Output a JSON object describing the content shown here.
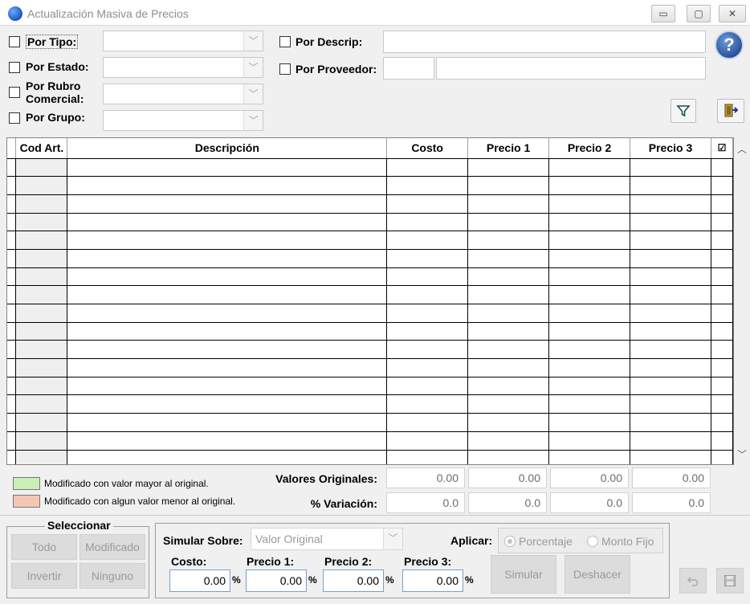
{
  "window": {
    "title": "Actualización Masiva de Precios",
    "controls": {
      "minimize": "▭",
      "maximize": "▢",
      "close": "✕"
    }
  },
  "filters": {
    "por_tipo": "Por Tipo:",
    "por_estado": "Por Estado:",
    "por_rubro_1": "Por Rubro",
    "por_rubro_2": "Comercial:",
    "por_grupo": "Por Grupo:",
    "por_descrip": "Por Descrip:",
    "por_proveedor": "Por Proveedor:",
    "combo_arrow": "﹀"
  },
  "help_label": "?",
  "icons": {
    "filter": "filter-icon",
    "exit": "exit-door-icon",
    "undo": "undo-icon",
    "save": "save-icon"
  },
  "grid": {
    "columns": [
      "Cod Art.",
      "Descripción",
      "Costo",
      "Precio 1",
      "Precio 2",
      "Precio 3",
      "☑"
    ],
    "row_count": 17
  },
  "legend": {
    "higher": "Modificado con valor mayor al original.",
    "lower": "Modificado con algun valor menor al original.",
    "higher_color": "#c9f1b7",
    "lower_color": "#f6c6b4"
  },
  "totals": {
    "originales_label": "Valores Originales:",
    "variacion_label": "% Variación:",
    "originales": [
      "0.00",
      "0.00",
      "0.00",
      "0.00"
    ],
    "variacion": [
      "0.0",
      "0.0",
      "0.0",
      "0.0"
    ]
  },
  "seleccionar": {
    "title": "Seleccionar",
    "todo": "Todo",
    "modificado": "Modificado",
    "invertir": "Invertir",
    "ninguno": "Ninguno"
  },
  "simular": {
    "simular_sobre": "Simular Sobre:",
    "valor_original": "Valor Original",
    "aplicar": "Aplicar:",
    "porcentaje": "Porcentaje",
    "monto_fijo": "Monto Fijo",
    "costo": "Costo:",
    "precio1": "Precio 1:",
    "precio2": "Precio 2:",
    "precio3": "Precio 3:",
    "costo_val": "0.00",
    "precio1_val": "0.00",
    "precio2_val": "0.00",
    "precio3_val": "0.00",
    "pct": "%",
    "simular_btn": "Simular",
    "deshacer_btn": "Deshacer"
  }
}
